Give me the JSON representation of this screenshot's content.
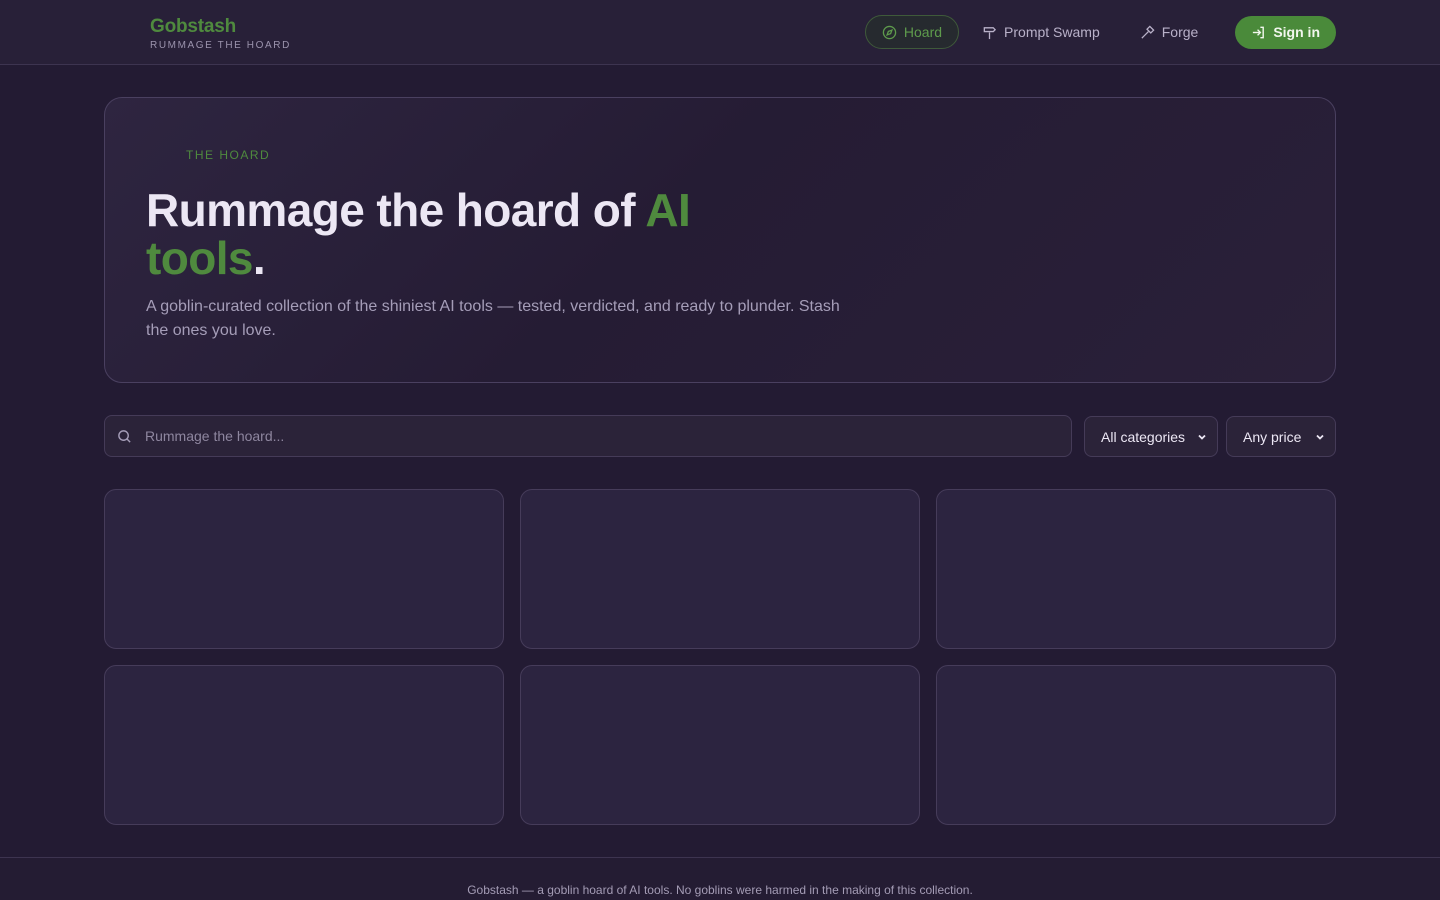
{
  "brand": {
    "name": "Gobstash",
    "tagline": "RUMMAGE THE HOARD"
  },
  "nav": {
    "items": [
      {
        "label": "Hoard",
        "icon": "compass-icon",
        "active": true
      },
      {
        "label": "Prompt Swamp",
        "icon": "signpost-icon",
        "active": false
      },
      {
        "label": "Forge",
        "icon": "hammer-icon",
        "active": false
      }
    ],
    "signin_label": "Sign in"
  },
  "hero": {
    "eyebrow": "THE HOARD",
    "title_part1": "Rummage the hoard of ",
    "title_accent": "AI tools",
    "title_end": ".",
    "subtitle": "A goblin-curated collection of the shiniest AI tools — tested, verdicted, and ready to plunder. Stash the ones you love."
  },
  "search": {
    "placeholder": "Rummage the hoard...",
    "value": ""
  },
  "filters": {
    "category": "All categories",
    "price": "Any price"
  },
  "cards": [
    {},
    {},
    {},
    {},
    {},
    {}
  ],
  "footer": {
    "text": "Gobstash — a goblin hoard of AI tools. No goblins were harmed in the making of this collection."
  },
  "colors": {
    "accent": "#4f8a3e",
    "background": "#231b33",
    "card": "#2c2440"
  }
}
